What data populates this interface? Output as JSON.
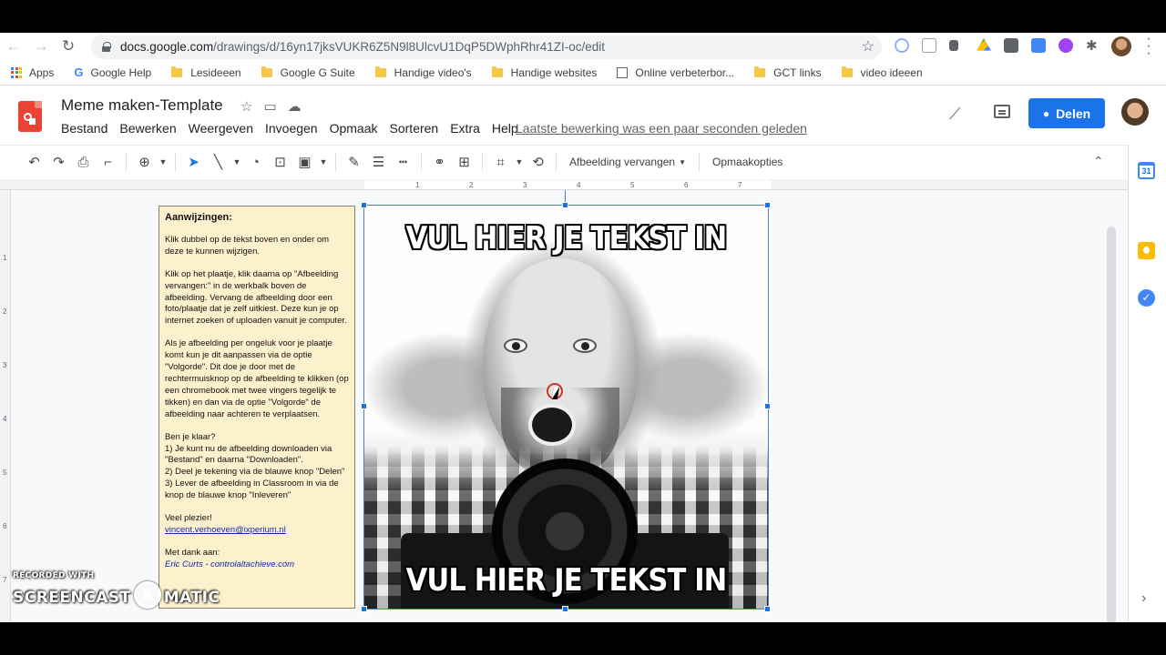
{
  "browser": {
    "url_host": "docs.google.com",
    "url_path": "/drawings/d/16yn17jksVUKR6Z5N9l8UlcvU1DqP5DWphRhr41ZI-oc/edit",
    "bookmarks": [
      {
        "label": "Apps",
        "icon": "apps-grid-icon"
      },
      {
        "label": "Google Help",
        "icon": "google-icon"
      },
      {
        "label": "Lesideeen",
        "icon": "folder-icon"
      },
      {
        "label": "Google G Suite",
        "icon": "folder-icon"
      },
      {
        "label": "Handige video's",
        "icon": "folder-icon"
      },
      {
        "label": "Handige websites",
        "icon": "folder-icon"
      },
      {
        "label": "Online verbeterbor...",
        "icon": "page-icon"
      },
      {
        "label": "GCT links",
        "icon": "folder-icon"
      },
      {
        "label": "video ideeen",
        "icon": "folder-icon"
      }
    ]
  },
  "docs": {
    "title": "Meme maken-Template",
    "menu": [
      "Bestand",
      "Bewerken",
      "Weergeven",
      "Invoegen",
      "Opmaak",
      "Sorteren",
      "Extra",
      "Help"
    ],
    "last_edit": "Laatste bewerking was een paar seconden geleden",
    "share_label": "Delen",
    "accent_color": "#1a73e8"
  },
  "toolbar": {
    "replace_image": "Afbeelding vervangen",
    "format_options": "Opmaakopties"
  },
  "ruler": {
    "top_ticks": [
      "1",
      "2",
      "3",
      "4",
      "5",
      "6",
      "7"
    ],
    "left_ticks": [
      "1",
      "2",
      "3",
      "4",
      "5",
      "6",
      "7"
    ]
  },
  "instructions": {
    "title": "Aanwijzingen:",
    "p1": "Klik dubbel op de tekst boven en onder om deze te kunnen wijzigen.",
    "p2": "Klik op het plaatje, klik daarna op \"Afbeelding vervangen:\" in de werkbalk boven de afbeelding. Vervang de afbeelding door een foto/plaatje dat je zelf uitkiest. Deze kun je op internet zoeken of uploaden vanuit je computer.",
    "p3": "Als je afbeelding per ongeluk voor je plaatje komt kun je dit aanpassen via de optie \"Volgorde\". Dit doe je door met de rechtermuisknop op de afbeelding te klikken (op een chromebook met twee vingers tegelijk te tikken) en dan via de optie \"Volgorde\" de afbeelding naar achteren te verplaatsen.",
    "p4_heading": "Ben je klaar?",
    "p4_line1": "1) Je kunt nu de afbeelding downloaden via \"Bestand\" en daarna \"Downloaden\".",
    "p4_line2": "2) Deel je tekening via de blauwe knop \"Delen\"",
    "p4_line3": "3) Lever de afbeelding in Classroom in via de knop de blauwe knop  \"Inleveren\"",
    "closing": "Veel plezier!",
    "email": "vincent.verhoeven@ixperium.nl",
    "credit_label": "Met dank aan:",
    "credit_name": "Eric Curts - controlaltachieve.com"
  },
  "meme": {
    "top_text": "VUL HIER JE TEKST IN",
    "bottom_text": "VUL HIER JE TEKST IN"
  },
  "watermark": {
    "line1": "RECORDED WITH",
    "line2_a": "SCREENCAST",
    "line2_b": "MATIC"
  },
  "sidepanel": {
    "calendar_day": "31"
  }
}
